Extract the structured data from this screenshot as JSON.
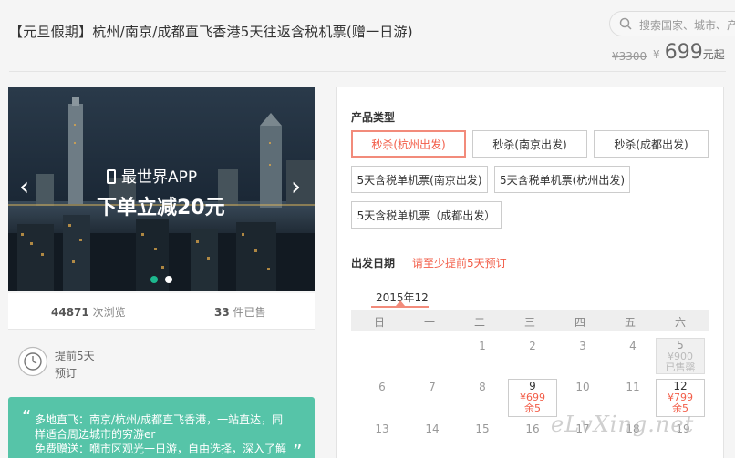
{
  "header": {
    "title": "【元旦假期】杭州/南京/成都直飞香港5天往返含税机票(赠一日游)",
    "search_placeholder": "搜索国家、城市、产",
    "original_price": "¥3300",
    "currency": "¥",
    "price": "699",
    "price_unit": "元起"
  },
  "banner": {
    "app_text": "最世界APP",
    "promo_text": "下单立减20元",
    "prev": "‹",
    "next": "›",
    "slide_count": 2,
    "active_slide": 1
  },
  "stats": {
    "views_count": "44871",
    "views_label": " 次浏览",
    "sold_count": "33",
    "sold_label": " 件已售"
  },
  "advance": {
    "line1": "提前5天",
    "line2": "预订"
  },
  "highlights": {
    "open_quote": "“",
    "close_quote": "”",
    "line1": "多地直飞：南京/杭州/成都直飞香港，一站直达，同",
    "line2": "样适合周边城市的穷游er",
    "line3": "免费赠送：嗰市区观光一日游，自由选择，深入了解"
  },
  "product": {
    "type_label": "产品类型",
    "options": [
      "秒杀(杭州出发)",
      "秒杀(南京出发)",
      "秒杀(成都出发)",
      "5天含税单机票(南京出发)",
      "5天含税单机票(杭州出发)",
      "5天含税单机票（成都出发）"
    ],
    "selected_index": 0,
    "date_label": "出发日期",
    "date_tip": "请至少提前5天预订"
  },
  "calendar": {
    "month": "2015年12",
    "weekdays": [
      "日",
      "一",
      "二",
      "三",
      "四",
      "五",
      "六"
    ],
    "row1": {
      "d1": "1",
      "d2": "2",
      "d3": "3",
      "d4": "4",
      "d5": "5",
      "d5_price": "¥900",
      "d5_status": "已售罄"
    },
    "row2": {
      "d6": "6",
      "d7": "7",
      "d8": "8",
      "d9": "9",
      "d9_price": "¥699",
      "d9_stock": "余5",
      "d10": "10",
      "d11": "11",
      "d12": "12",
      "d12_price": "¥799",
      "d12_stock": "余5"
    },
    "row3": {
      "d13": "13",
      "d14": "14",
      "d15": "15",
      "d16": "16",
      "d17": "17",
      "d18": "18",
      "d19": "19"
    }
  },
  "watermark": "eLvXing.net",
  "colors": {
    "accent": "#f25d48",
    "highlight_bg": "#56c4a8",
    "dot_active": "#1db88e"
  }
}
